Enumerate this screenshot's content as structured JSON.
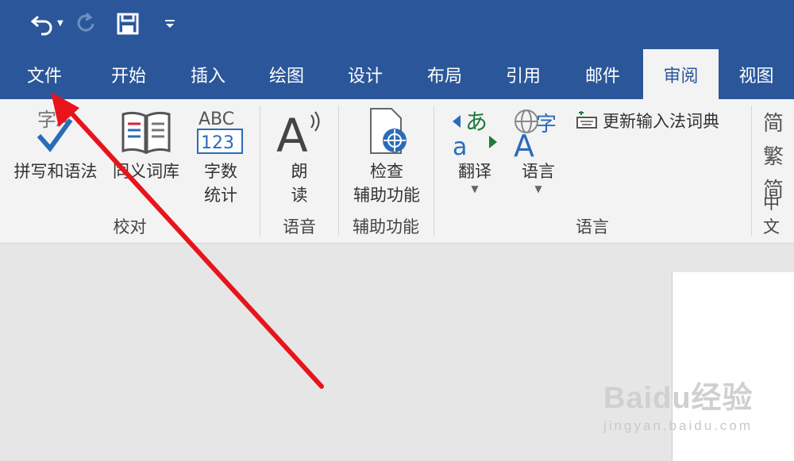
{
  "quick_access": {
    "undo_icon": "undo-icon",
    "redo_icon": "redo-icon",
    "save_icon": "save-icon",
    "customize_icon": "customize-qat-icon"
  },
  "tabs": [
    {
      "label": "文件",
      "active": false
    },
    {
      "label": "开始",
      "active": false
    },
    {
      "label": "插入",
      "active": false
    },
    {
      "label": "绘图",
      "active": false
    },
    {
      "label": "设计",
      "active": false
    },
    {
      "label": "布局",
      "active": false
    },
    {
      "label": "引用",
      "active": false
    },
    {
      "label": "邮件",
      "active": false
    },
    {
      "label": "审阅",
      "active": true
    },
    {
      "label": "视图",
      "active": false
    }
  ],
  "ribbon": {
    "proofing": {
      "label": "校对",
      "spelling": "拼写和语法",
      "thesaurus": "同义词库",
      "wordcount": "字数\n统计",
      "spelling_icon_text": "字A",
      "wordcount_icon_top": "ABC",
      "wordcount_icon_bottom": "123"
    },
    "speech": {
      "label": "语音",
      "read_aloud": "朗\n读"
    },
    "accessibility": {
      "label": "辅助功能",
      "check": "检查\n辅助功能"
    },
    "language": {
      "label": "语言",
      "translate": "翻译",
      "language": "语言",
      "update_ime": "更新输入法词典",
      "translate_icon_text": "あ",
      "language_icon_text": "字"
    },
    "chinese": {
      "label": "中文",
      "trad_to_simp": "简",
      "simp_to_trad": "繁",
      "conversion": "简"
    }
  },
  "watermark": {
    "brand": "Baidu经验",
    "url": "jingyan.baidu.com"
  },
  "colors": {
    "title_bar": "#2b579a",
    "ribbon": "#f3f3f3",
    "arrow": "#e8141c"
  }
}
